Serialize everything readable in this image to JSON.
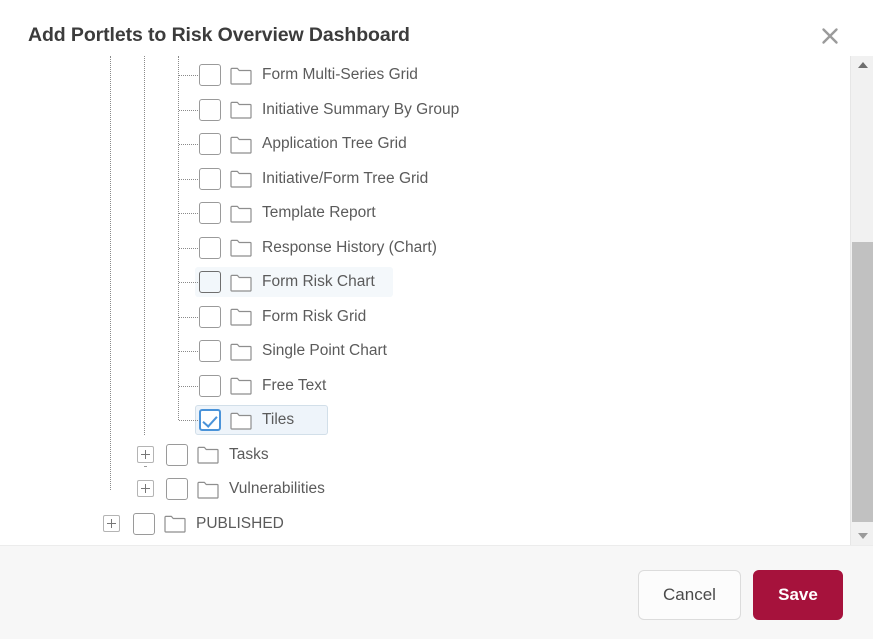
{
  "dialog": {
    "title": "Add Portlets to Risk Overview Dashboard",
    "close_icon": "close-icon"
  },
  "tree": {
    "rows": [
      {
        "label": "Form Multi-Series Grid",
        "depth": 3,
        "checked": false,
        "expandable": false,
        "state": "normal"
      },
      {
        "label": "Initiative Summary By Group",
        "depth": 3,
        "checked": false,
        "expandable": false,
        "state": "normal"
      },
      {
        "label": "Application Tree Grid",
        "depth": 3,
        "checked": false,
        "expandable": false,
        "state": "normal"
      },
      {
        "label": "Initiative/Form Tree Grid",
        "depth": 3,
        "checked": false,
        "expandable": false,
        "state": "normal"
      },
      {
        "label": "Template Report",
        "depth": 3,
        "checked": false,
        "expandable": false,
        "state": "normal"
      },
      {
        "label": "Response History (Chart)",
        "depth": 3,
        "checked": false,
        "expandable": false,
        "state": "normal"
      },
      {
        "label": "Form Risk Chart",
        "depth": 3,
        "checked": false,
        "expandable": false,
        "state": "hover"
      },
      {
        "label": "Form Risk Grid",
        "depth": 3,
        "checked": false,
        "expandable": false,
        "state": "normal"
      },
      {
        "label": "Single Point Chart",
        "depth": 3,
        "checked": false,
        "expandable": false,
        "state": "normal"
      },
      {
        "label": "Free Text",
        "depth": 3,
        "checked": false,
        "expandable": false,
        "state": "normal"
      },
      {
        "label": "Tiles",
        "depth": 3,
        "checked": true,
        "expandable": false,
        "state": "selected"
      },
      {
        "label": "Tasks",
        "depth": 2,
        "checked": false,
        "expandable": true,
        "state": "normal"
      },
      {
        "label": "Vulnerabilities",
        "depth": 2,
        "checked": false,
        "expandable": true,
        "state": "normal"
      },
      {
        "label": "PUBLISHED",
        "depth": 1,
        "checked": false,
        "expandable": true,
        "state": "normal"
      }
    ],
    "folder_icon": "folder-icon",
    "expand_icon": "plus-expand-icon",
    "checked_icon": "checkmark-icon"
  },
  "scrollbar": {
    "up_icon": "scroll-up-arrow-icon",
    "down_icon": "scroll-down-arrow-icon",
    "thumb": "scrollbar-thumb"
  },
  "footer": {
    "cancel_label": "Cancel",
    "save_label": "Save"
  },
  "colors": {
    "save_button": "#a6123c",
    "checkbox_checked_border": "#4a93d9",
    "selected_row_bg": "#eef4fa",
    "hover_row_bg": "#f4f8fb",
    "text": "#5b5b5b",
    "title_text": "#3c3c3c",
    "footer_bg": "#f7f7f7",
    "scrollbar_thumb": "#c1c1c1"
  }
}
